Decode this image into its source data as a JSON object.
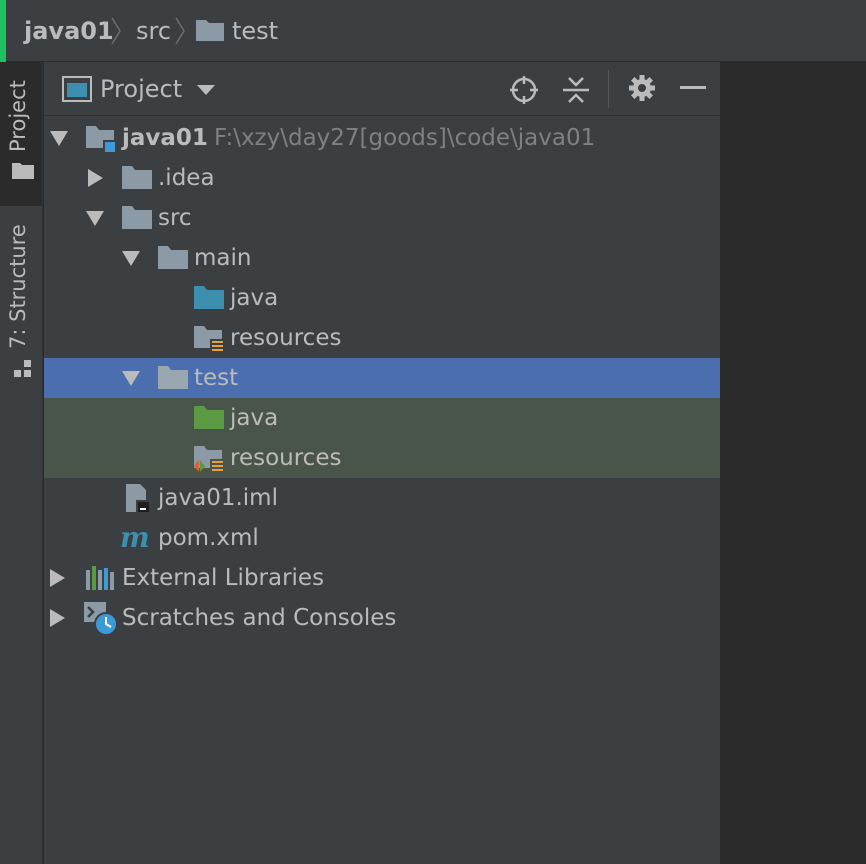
{
  "breadcrumb": [
    "java01",
    "src",
    "test"
  ],
  "stripe": {
    "project_tab": "Project",
    "structure_tab": "7: Structure"
  },
  "panel": {
    "title": "Project",
    "icons": [
      "locate-icon",
      "collapse-all-icon",
      "gear-icon",
      "minimize-icon"
    ]
  },
  "tree": {
    "root": {
      "name": "java01",
      "path": "F:\\xzy\\day27[goods]\\code\\java01"
    },
    "idea": ".idea",
    "src": "src",
    "main": "main",
    "main_java": "java",
    "main_resources": "resources",
    "test": "test",
    "test_java": "java",
    "test_resources": "resources",
    "iml": "java01.iml",
    "pom": "pom.xml",
    "external_libraries": "External Libraries",
    "scratches": "Scratches and Consoles"
  },
  "colors": {
    "selection": "#4b6eaf",
    "test_root_bg": "#49544a",
    "source_folder": "#3d8fb0",
    "test_folder": "#5a9a43",
    "folder": "#8c9aa6",
    "accent_green": "#1ec35f"
  }
}
